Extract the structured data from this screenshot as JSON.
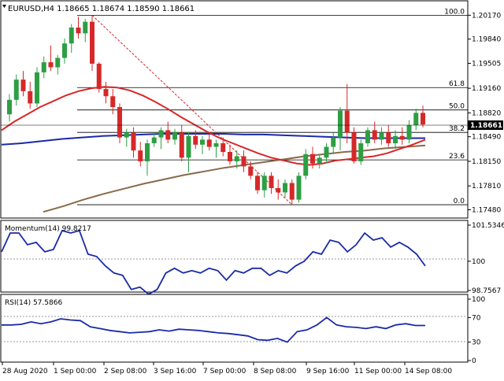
{
  "header": {
    "symbol": "EURUSD,H4",
    "ohlc": "1.18665 1.18674 1.18590 1.18661"
  },
  "colors": {
    "bull": "#2e9e44",
    "bear": "#d62828",
    "ema_fast": "#d62828",
    "ema_mid": "#1a2aa8",
    "ema_slow": "#8a6a4a",
    "osc": "#1a2aa8",
    "fib": "#000000",
    "trend": "#d62828"
  },
  "main_pane": {
    "price_labels": [
      "1.20170",
      "1.19840",
      "1.19505",
      "1.19160",
      "1.18820",
      "1.18490",
      "1.18150",
      "1.17810",
      "1.17480"
    ],
    "current_price": "1.18661",
    "fib_levels": [
      {
        "label": "100.0",
        "price": 1.2017
      },
      {
        "label": "61.8",
        "price": 1.1917
      },
      {
        "label": "50.0",
        "price": 1.1886
      },
      {
        "label": "38.2",
        "price": 1.1855
      },
      {
        "label": "23.6",
        "price": 1.1817
      },
      {
        "label": "0.0",
        "price": 1.1755
      }
    ]
  },
  "momentum_pane": {
    "title": "Momentum(14) 99.8217",
    "labels": [
      "101.5346",
      "100",
      "98.7567"
    ]
  },
  "rsi_pane": {
    "title": "RSI(14) 57.5866",
    "labels": [
      "100",
      "70",
      "30",
      "0"
    ]
  },
  "time_axis": [
    "28 Aug 2020",
    "1 Sep 00:00",
    "2 Sep 08:00",
    "3 Sep 16:00",
    "7 Sep 00:00",
    "8 Sep 08:00",
    "9 Sep 16:00",
    "11 Sep 00:00",
    "14 Sep 08:00"
  ],
  "chart_data": [
    {
      "type": "candlestick",
      "title": "EURUSD,H4",
      "ylim": [
        1.1742,
        1.2025
      ],
      "candles": [
        [
          1.188,
          1.1908,
          1.187,
          1.19
        ],
        [
          1.19,
          1.1935,
          1.1892,
          1.1928
        ],
        [
          1.1928,
          1.194,
          1.1905,
          1.1912
        ],
        [
          1.1912,
          1.1925,
          1.1888,
          1.1895
        ],
        [
          1.1895,
          1.1945,
          1.189,
          1.1938
        ],
        [
          1.1938,
          1.196,
          1.193,
          1.1952
        ],
        [
          1.1952,
          1.1975,
          1.194,
          1.1945
        ],
        [
          1.1945,
          1.1962,
          1.1935,
          1.1958
        ],
        [
          1.1958,
          1.1985,
          1.195,
          1.1978
        ],
        [
          1.1978,
          1.2005,
          1.1965,
          1.2
        ],
        [
          1.2,
          1.2015,
          1.1985,
          1.1992
        ],
        [
          1.1992,
          1.2012,
          1.198,
          1.2008
        ],
        [
          1.2008,
          1.2017,
          1.194,
          1.195
        ],
        [
          1.195,
          1.1952,
          1.191,
          1.1915
        ],
        [
          1.1915,
          1.1925,
          1.1895,
          1.1905
        ],
        [
          1.1905,
          1.1915,
          1.188,
          1.189
        ],
        [
          1.189,
          1.1895,
          1.184,
          1.1848
        ],
        [
          1.1848,
          1.186,
          1.1835,
          1.1855
        ],
        [
          1.1855,
          1.1862,
          1.182,
          1.183
        ],
        [
          1.183,
          1.1842,
          1.1808,
          1.1815
        ],
        [
          1.1815,
          1.1845,
          1.1795,
          1.184
        ],
        [
          1.184,
          1.1855,
          1.1835,
          1.1848
        ],
        [
          1.1848,
          1.1862,
          1.1832,
          1.1858
        ],
        [
          1.1858,
          1.187,
          1.184,
          1.1845
        ],
        [
          1.1845,
          1.186,
          1.1838,
          1.1855
        ],
        [
          1.1855,
          1.1865,
          1.1815,
          1.182
        ],
        [
          1.182,
          1.1855,
          1.18,
          1.185
        ],
        [
          1.185,
          1.1858,
          1.1832,
          1.1838
        ],
        [
          1.1838,
          1.185,
          1.1825,
          1.1845
        ],
        [
          1.1845,
          1.1852,
          1.183,
          1.1835
        ],
        [
          1.1835,
          1.1845,
          1.182,
          1.184
        ],
        [
          1.184,
          1.1848,
          1.1822,
          1.1828
        ],
        [
          1.1828,
          1.1838,
          1.181,
          1.1815
        ],
        [
          1.1815,
          1.183,
          1.1805,
          1.1822
        ],
        [
          1.1822,
          1.183,
          1.18,
          1.1808
        ],
        [
          1.1808,
          1.1815,
          1.179,
          1.1795
        ],
        [
          1.1795,
          1.18,
          1.177,
          1.1775
        ],
        [
          1.1775,
          1.18,
          1.1765,
          1.1795
        ],
        [
          1.1795,
          1.18,
          1.177,
          1.1778
        ],
        [
          1.1778,
          1.179,
          1.1762,
          1.1772
        ],
        [
          1.1772,
          1.179,
          1.1765,
          1.1785
        ],
        [
          1.1785,
          1.179,
          1.1755,
          1.1762
        ],
        [
          1.1762,
          1.18,
          1.1758,
          1.1795
        ],
        [
          1.1795,
          1.1832,
          1.179,
          1.1825
        ],
        [
          1.1825,
          1.1835,
          1.1805,
          1.1812
        ],
        [
          1.1812,
          1.1825,
          1.1805,
          1.182
        ],
        [
          1.182,
          1.184,
          1.1812,
          1.1835
        ],
        [
          1.1835,
          1.1855,
          1.1825,
          1.1848
        ],
        [
          1.1848,
          1.189,
          1.183,
          1.1885
        ],
        [
          1.1885,
          1.1922,
          1.184,
          1.1855
        ],
        [
          1.1855,
          1.1862,
          1.1812,
          1.1815
        ],
        [
          1.1815,
          1.1845,
          1.181,
          1.184
        ],
        [
          1.184,
          1.1862,
          1.1835,
          1.1858
        ],
        [
          1.1858,
          1.187,
          1.184,
          1.1845
        ],
        [
          1.1845,
          1.1862,
          1.1838,
          1.1855
        ],
        [
          1.1855,
          1.1865,
          1.1835,
          1.184
        ],
        [
          1.184,
          1.1858,
          1.1832,
          1.185
        ],
        [
          1.185,
          1.1862,
          1.1838,
          1.1845
        ],
        [
          1.1845,
          1.1872,
          1.184,
          1.1865
        ],
        [
          1.1865,
          1.1888,
          1.1858,
          1.1882
        ],
        [
          1.1882,
          1.1892,
          1.1862,
          1.1866
        ]
      ],
      "ema_fast": [
        1.1858,
        1.187,
        1.188,
        1.189,
        1.1898,
        1.1906,
        1.1912,
        1.1916,
        1.1918,
        1.1917,
        1.1913,
        1.1906,
        1.1897,
        1.1887,
        1.1876,
        1.1866,
        1.1856,
        1.1847,
        1.184,
        1.1833,
        1.1826,
        1.182,
        1.1816,
        1.1812,
        1.181,
        1.1812,
        1.1816,
        1.1818,
        1.182,
        1.1822,
        1.1826,
        1.1832,
        1.1838,
        1.1845
      ],
      "ema_mid": [
        1.1838,
        1.184,
        1.1843,
        1.1846,
        1.1848,
        1.185,
        1.1851,
        1.1852,
        1.1853,
        1.1853,
        1.1853,
        1.1853,
        1.1852,
        1.1852,
        1.1851,
        1.185,
        1.1849,
        1.1848,
        1.1847,
        1.1847,
        1.1847,
        1.1847
      ],
      "ema_slow": [
        1.1745,
        1.1753,
        1.1762,
        1.177,
        1.1777,
        1.1784,
        1.179,
        1.1796,
        1.1801,
        1.1806,
        1.181,
        1.1814,
        1.1818,
        1.1822,
        1.1825,
        1.1828,
        1.183,
        1.1833,
        1.1835,
        1.1837
      ]
    },
    {
      "type": "line",
      "title": "Momentum(14) 99.8217",
      "series": [
        {
          "values": [
            100.4,
            101.2,
            101.2,
            100.7,
            100.8,
            100.4,
            100.5,
            101.3,
            101.2,
            101.3,
            100.3,
            100.2,
            99.8,
            99.5,
            99.4,
            98.8,
            98.9,
            98.6,
            98.8,
            99.5,
            99.7,
            99.5,
            99.6,
            99.5,
            99.7,
            99.6,
            99.2,
            99.6,
            99.5,
            99.7,
            99.7,
            99.4,
            99.6,
            99.5,
            99.8,
            100.0,
            100.4,
            100.3,
            100.9,
            100.8,
            100.4,
            100.7,
            101.2,
            100.9,
            101.0,
            100.6,
            100.8,
            100.6,
            100.3,
            99.8
          ]
        }
      ]
    },
    {
      "type": "line",
      "title": "RSI(14) 57.5866",
      "series": [
        {
          "values": [
            58,
            58,
            59,
            63,
            60,
            63,
            68,
            66,
            65,
            55,
            52,
            49,
            47,
            45,
            46,
            47,
            50,
            48,
            51,
            50,
            49,
            47,
            45,
            44,
            42,
            40,
            34,
            33,
            36,
            30,
            47,
            50,
            58,
            70,
            58,
            55,
            54,
            52,
            55,
            52,
            58,
            60,
            57,
            57
          ]
        }
      ]
    }
  ]
}
